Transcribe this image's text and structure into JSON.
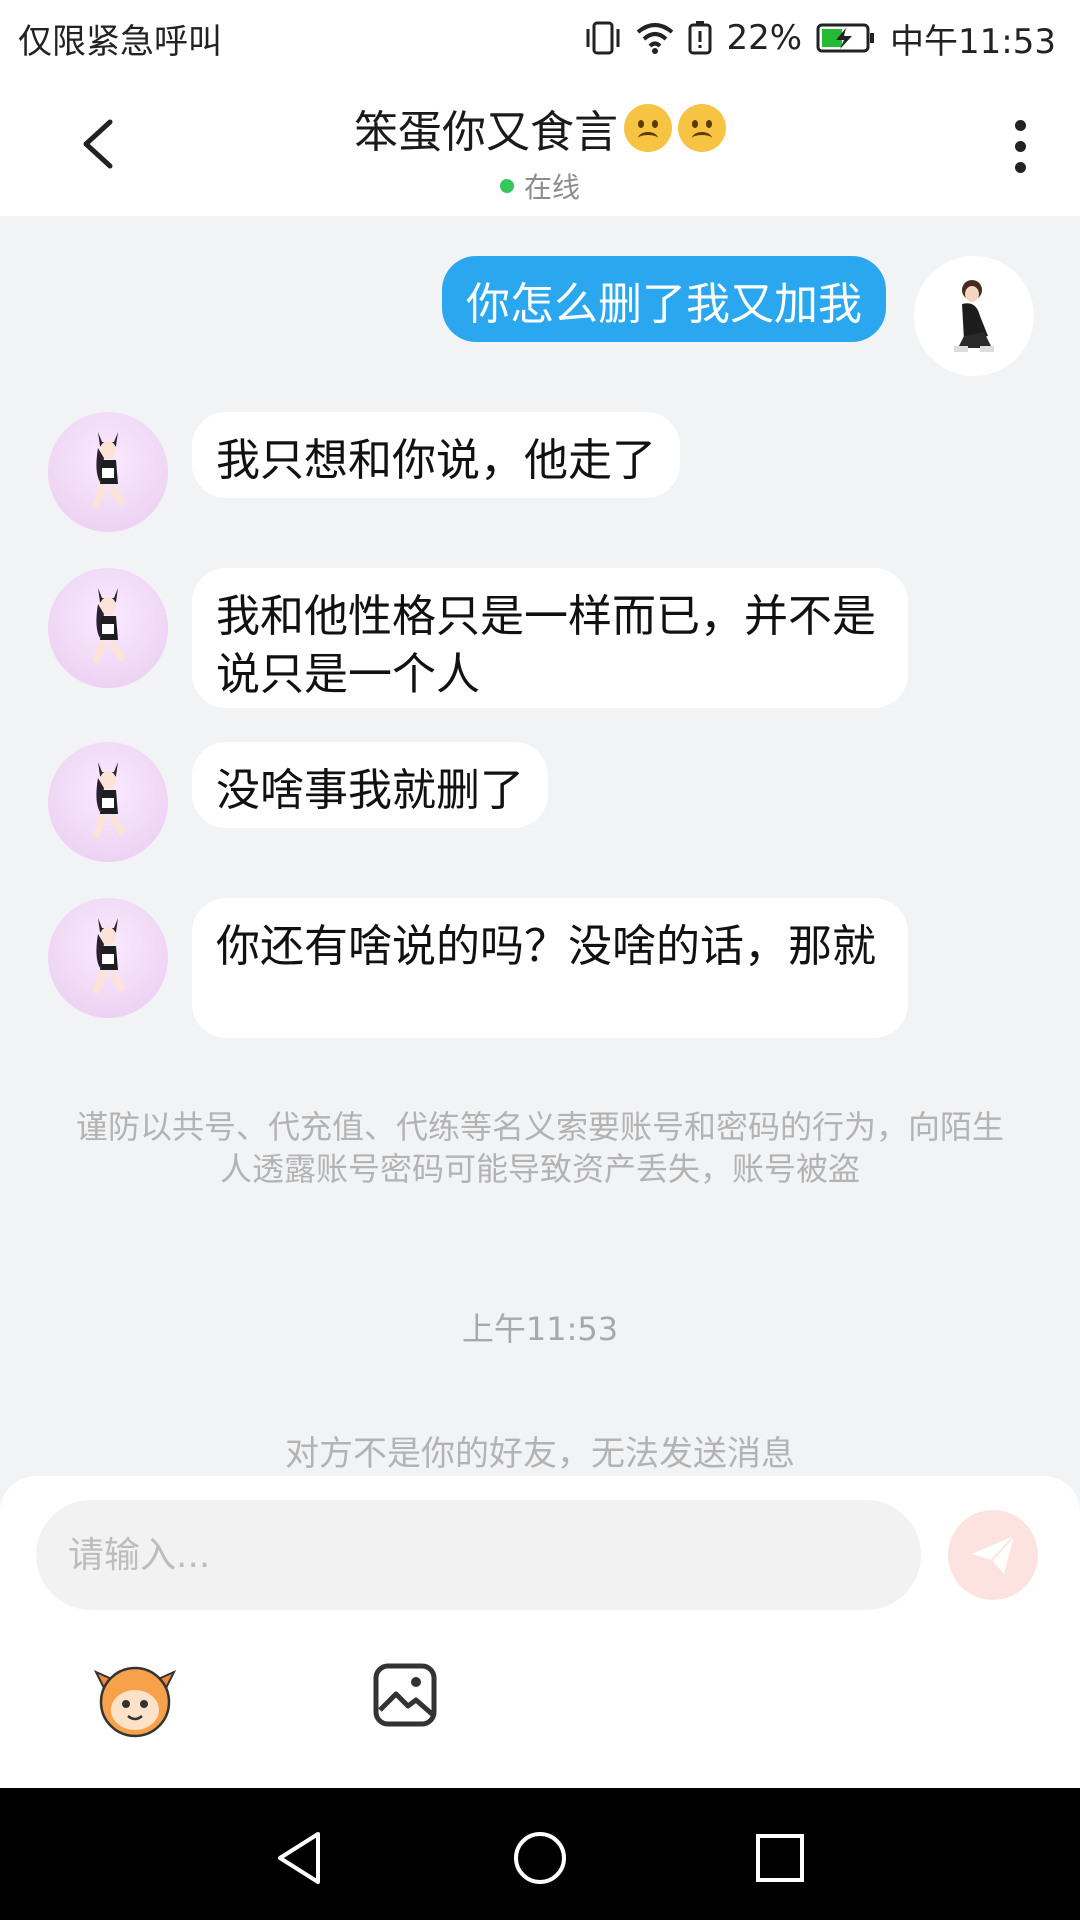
{
  "status_bar": {
    "carrier_text": "仅限紧急呼叫",
    "battery_percent": "22%",
    "time": "中午11:53",
    "icons": [
      "vibrate-icon",
      "wifi-icon",
      "battery-alert-icon",
      "battery-charging-icon"
    ]
  },
  "header": {
    "title": "笨蛋你又食言",
    "title_emojis": [
      "confused-face",
      "frowning-face"
    ],
    "status": "在线",
    "online_color": "#34c759"
  },
  "messages": [
    {
      "side": "right",
      "text": "你怎么删了我又加我"
    },
    {
      "side": "left",
      "text": "我只想和你说，他走了"
    },
    {
      "side": "left",
      "text": "我和他性格只是一样而已，并不是说只是一个人"
    },
    {
      "side": "left",
      "text": "没啥事我就删了"
    },
    {
      "side": "left",
      "text": "你还有啥说的吗？没啥的话，那就"
    }
  ],
  "notice": "谨防以共号、代充值、代练等名义索要账号和密码的行为，向陌生人透露账号密码可能导致资产丢失，账号被盗",
  "time_label": "上午11:53",
  "not_friend_text": "对方不是你的好友，无法发送消息",
  "input": {
    "placeholder": "请输入..."
  },
  "colors": {
    "accent": "#2aa7ee",
    "send_disabled": "#fde3df",
    "background": "#f2f3f5"
  }
}
